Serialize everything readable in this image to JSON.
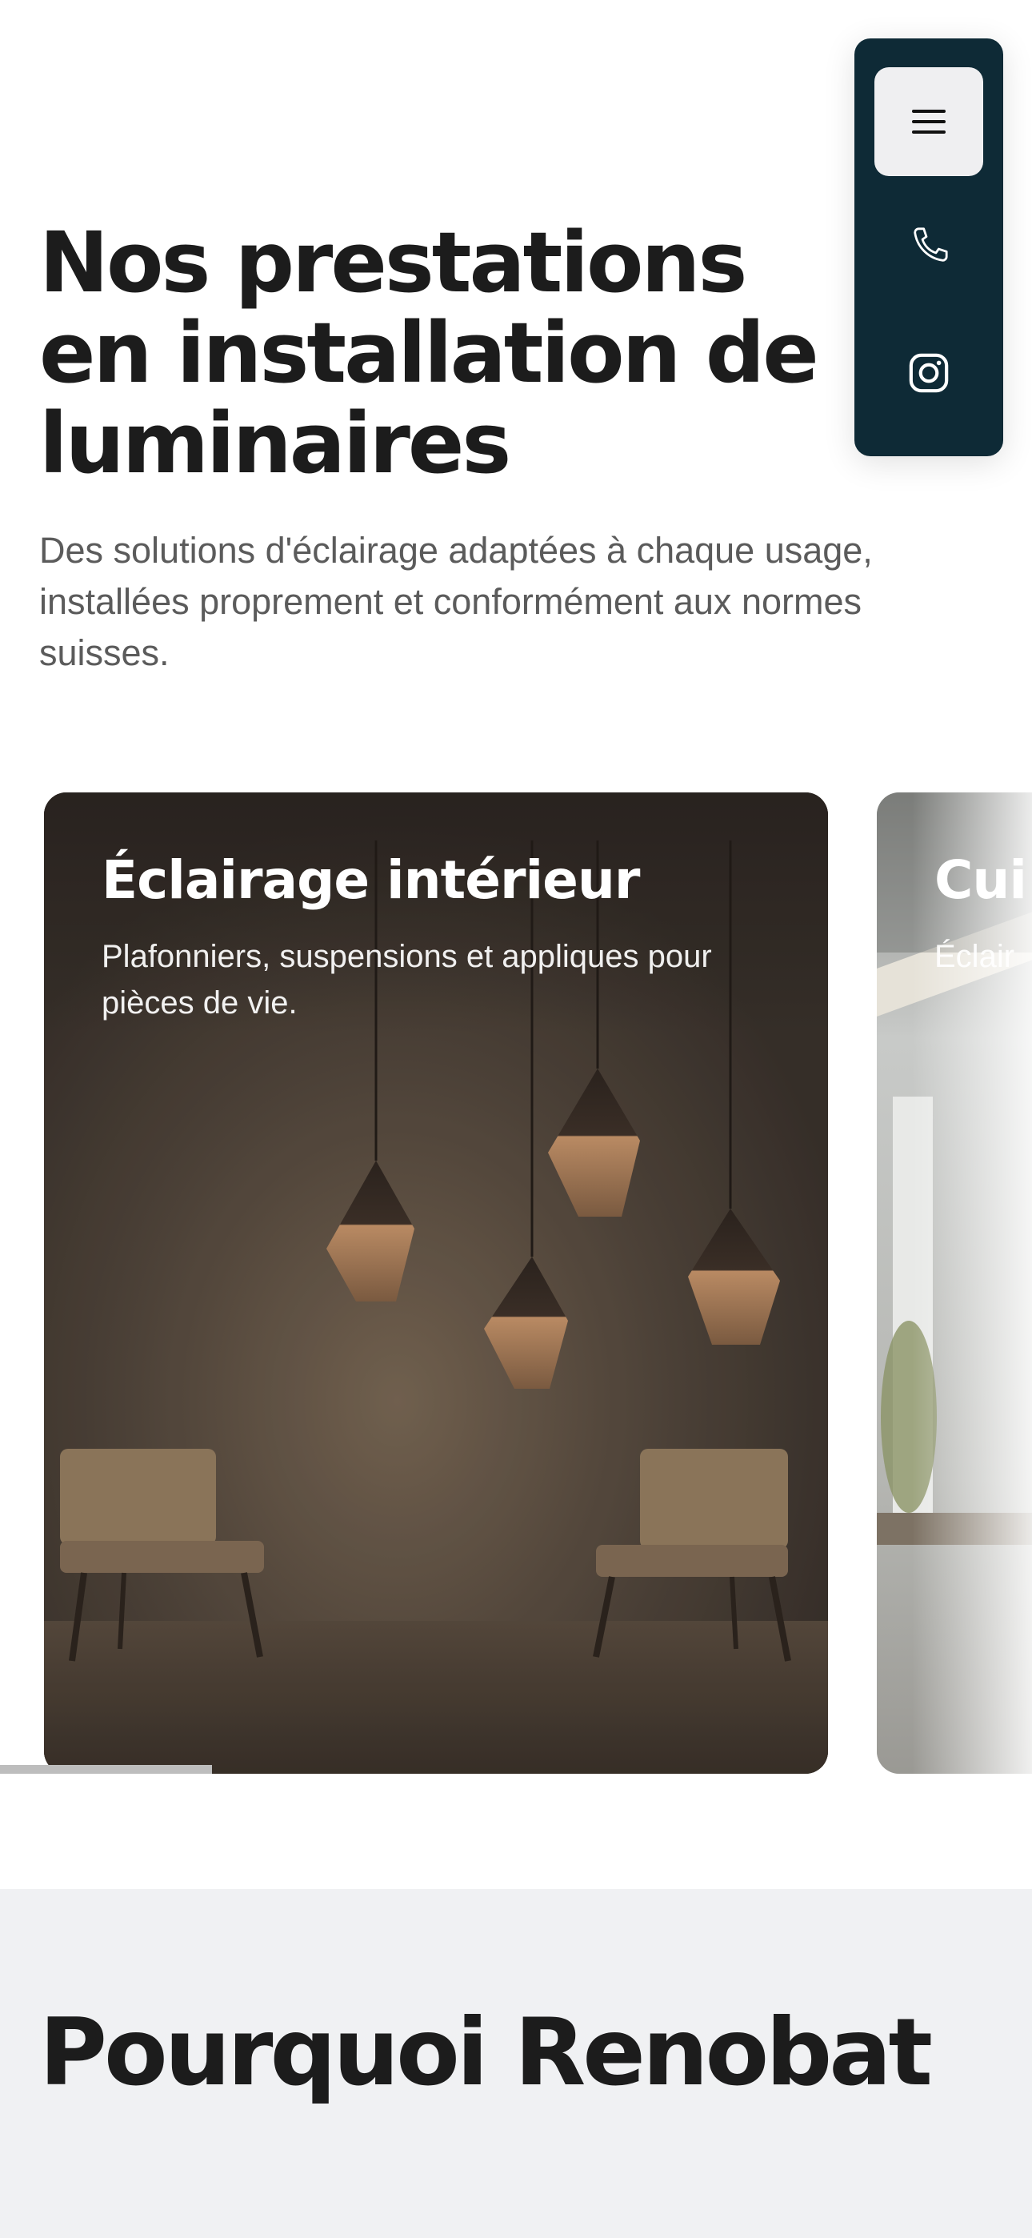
{
  "nav": {
    "menu_icon": "hamburger-icon",
    "phone_icon": "phone-icon",
    "instagram_icon": "instagram-icon",
    "background_color": "#0e2a36"
  },
  "hero": {
    "title": "Nos prestations en installation de luminaires",
    "subtitle": "Des solutions d'éclairage adaptées à chaque usage, installées proprement et conformément aux normes suisses."
  },
  "services": {
    "cards": [
      {
        "title": "Éclairage intérieur",
        "description": "Plafonniers, suspensions et appliques pour pièces de vie."
      },
      {
        "title": "Cui",
        "description": "Éclair"
      }
    ],
    "scroll_progress": 0.2
  },
  "why": {
    "title": "Pourquoi Renobat"
  }
}
